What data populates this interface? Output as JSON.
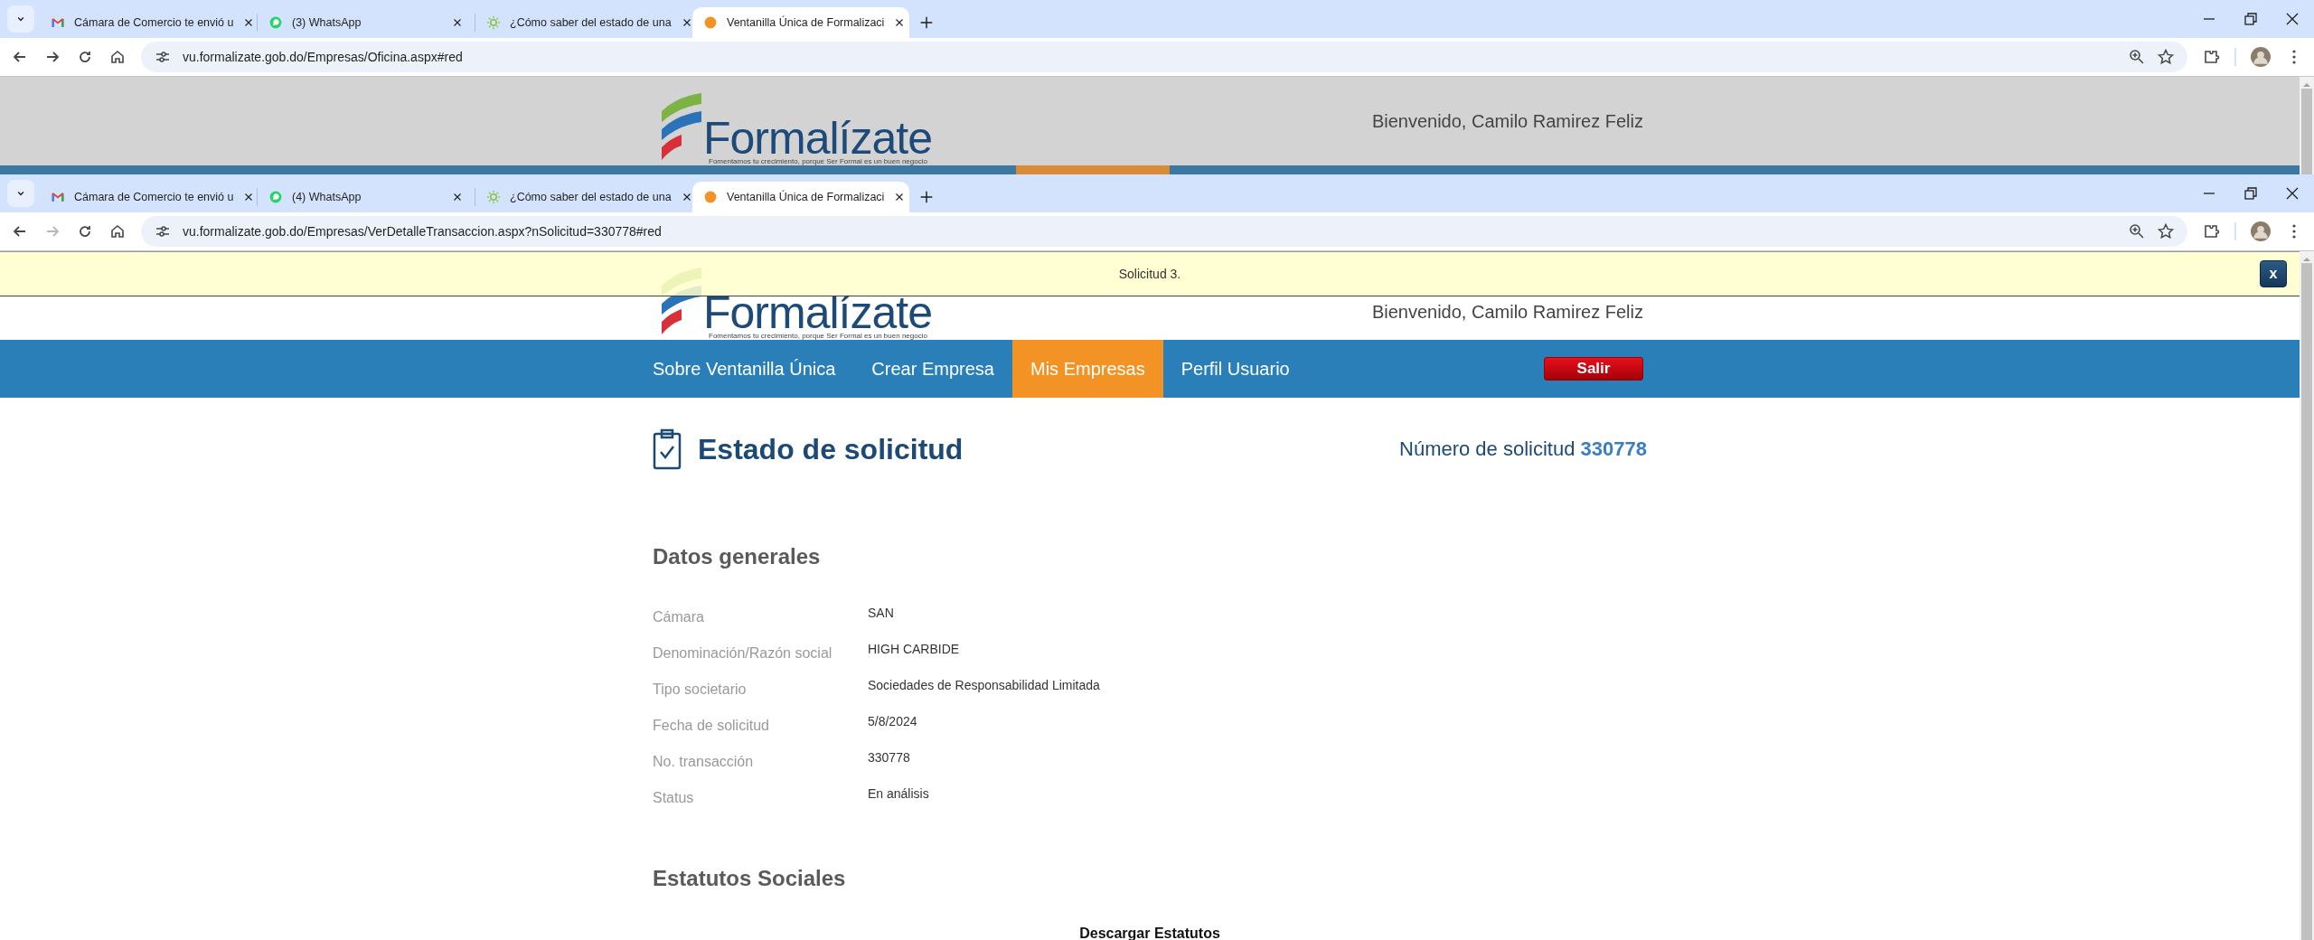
{
  "windows": [
    {
      "tabs": [
        {
          "title": "Cámara de Comercio te envió u",
          "kind": "mail",
          "selected": false
        },
        {
          "title": "(3) WhatsApp",
          "kind": "chat",
          "selected": false
        },
        {
          "title": "¿Cómo saber del estado de una",
          "kind": "sun",
          "selected": false
        },
        {
          "title": "Ventanilla Única de Formalizaci",
          "kind": "dot",
          "selected": true
        }
      ],
      "url": "vu.formalizate.gob.do/Empresas/Oficina.aspx#red",
      "forward_enabled": true,
      "page": {
        "logo": {
          "name": "Formalízate",
          "tagline": "Fomentamos tu crecimiento, porque Ser Formal es un buen negocio"
        },
        "welcome": "Bienvenido, Camilo Ramirez Feliz"
      }
    },
    {
      "tabs": [
        {
          "title": "Cámara de Comercio te envió u",
          "kind": "mail",
          "selected": false
        },
        {
          "title": "(4) WhatsApp",
          "kind": "chat",
          "selected": false
        },
        {
          "title": "¿Cómo saber del estado de una",
          "kind": "sun",
          "selected": false
        },
        {
          "title": "Ventanilla Única de Formalizaci",
          "kind": "dot",
          "selected": true
        }
      ],
      "url": "vu.formalizate.gob.do/Empresas/VerDetalleTransaccion.aspx?nSolicitud=330778#red",
      "forward_enabled": false,
      "banner": {
        "message": "Solicitud 3.",
        "close": "x"
      },
      "page": {
        "logo": {
          "name": "Formalízate",
          "tagline": "Fomentamos tu crecimiento, porque Ser Formal es un buen negocio"
        },
        "welcome": "Bienvenido, Camilo Ramirez Feliz",
        "nav": [
          {
            "label": "Sobre Ventanilla Única",
            "selected": false
          },
          {
            "label": "Crear Empresa",
            "selected": false
          },
          {
            "label": "Mis Empresas",
            "selected": true
          },
          {
            "label": "Perfil Usuario",
            "selected": false
          }
        ],
        "logout": "Salir",
        "title": "Estado de solicitud",
        "request_label": "Número de solicitud",
        "request_number": "330778",
        "general_title": "Datos generales",
        "fields": [
          {
            "label": "Cámara",
            "value": "SAN"
          },
          {
            "label": "Denominación/Razón social",
            "value": "HIGH CARBIDE"
          },
          {
            "label": "Tipo societario",
            "value": "Sociedades de Responsabilidad Limitada"
          },
          {
            "label": "Fecha de solicitud",
            "value": "5/8/2024"
          },
          {
            "label": "No. transacción",
            "value": "330778"
          },
          {
            "label": "Status",
            "value": "En análisis"
          }
        ],
        "statutes_title": "Estatutos Sociales",
        "download_link": "Descargar Estatutos"
      }
    }
  ]
}
